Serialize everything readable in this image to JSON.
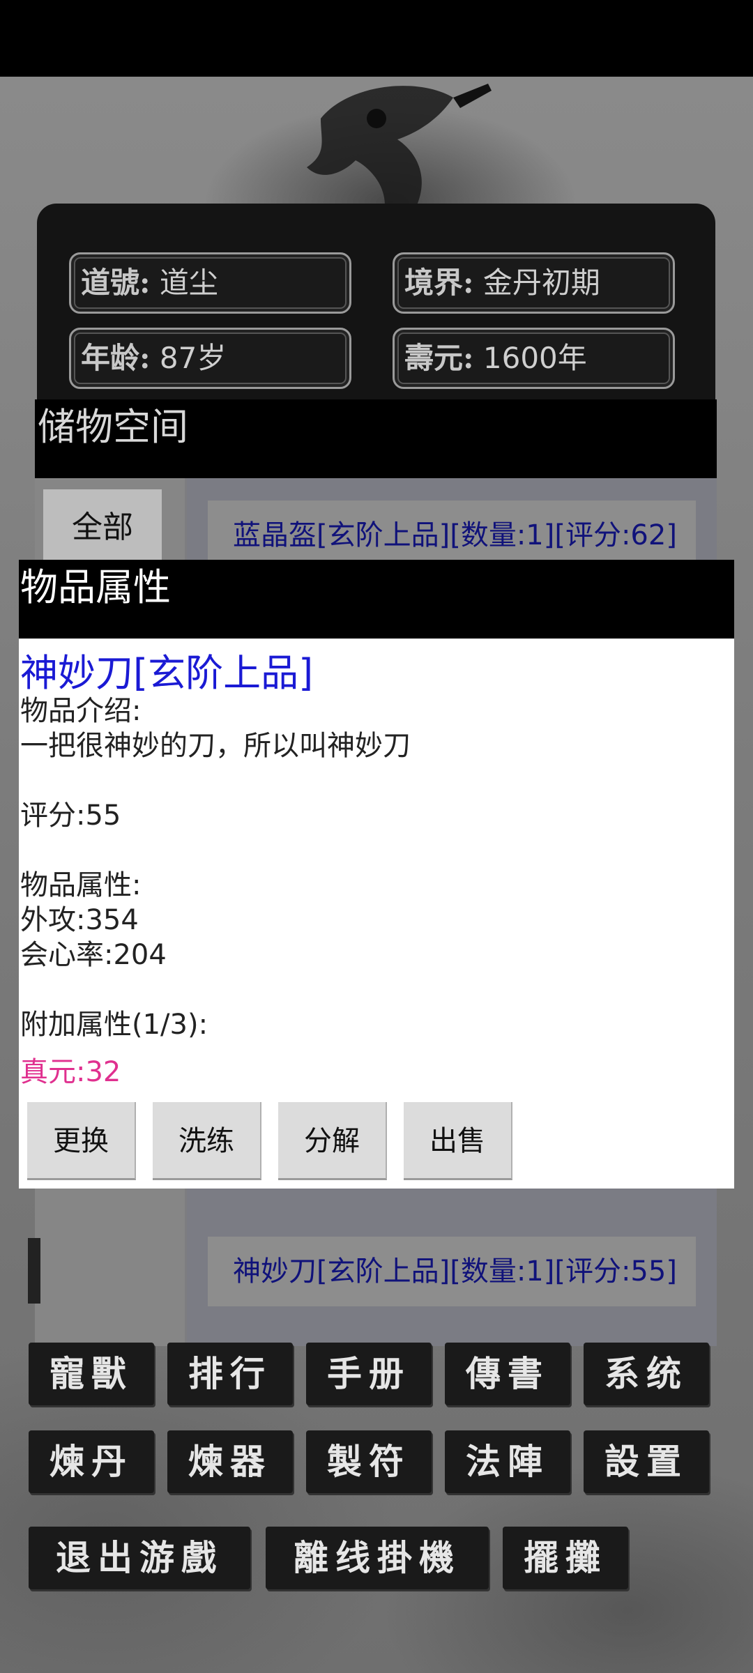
{
  "player": {
    "daohao_label": "道號:",
    "daohao_value": "道尘",
    "jingjie_label": "境界:",
    "jingjie_value": "金丹初期",
    "age_label": "年龄:",
    "age_value": "87岁",
    "shouyuan_label": "壽元:",
    "shouyuan_value": "1600年"
  },
  "storage": {
    "title": "储物空间",
    "filter_all": "全部",
    "items": [
      "蓝晶盔[玄阶上品][数量:1][评分:62]",
      "神妙刀[玄阶上品][数量:1][评分:55]"
    ]
  },
  "dialog": {
    "title": "物品属性",
    "item_name": "神妙刀[玄阶上品]",
    "body_text": "物品介绍:\n一把很神妙的刀，所以叫神妙刀\n\n评分:55\n\n物品属性:\n外攻:354\n会心率:204\n\n附加属性(1/3):",
    "extra_attr": "真元:32",
    "buttons": {
      "replace": "更换",
      "refine": "洗练",
      "decompose": "分解",
      "sell": "出售"
    }
  },
  "menu": {
    "row1": [
      "寵獸",
      "排行",
      "手册",
      "傳書",
      "系统"
    ],
    "row2": [
      "煉丹",
      "煉器",
      "製符",
      "法陣",
      "設置"
    ],
    "row3": [
      "退出游戲",
      "離线掛機",
      "擺攤"
    ]
  },
  "colors": {
    "item_name": "#1a1ad4",
    "extra_attr": "#e0308f",
    "list_item_text": "#10127a"
  }
}
